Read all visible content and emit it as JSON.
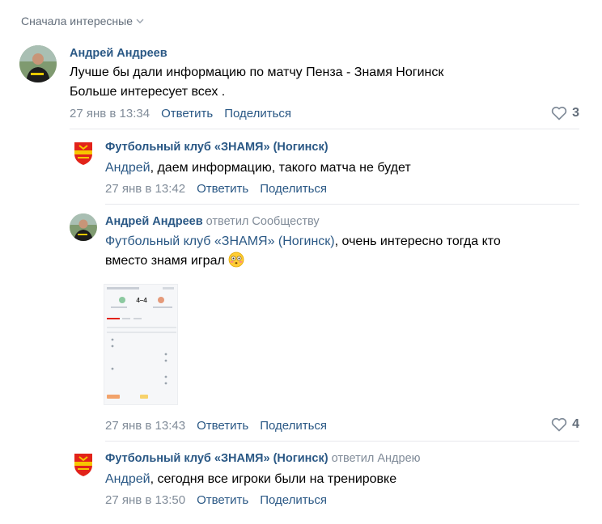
{
  "sort": {
    "label": "Сначала интересные"
  },
  "comments": [
    {
      "author": "Андрей Андреев",
      "lines": [
        "Лучше бы дали информацию по матчу Пенза - Знамя Ногинск",
        "Больше интересует всех ."
      ],
      "date": "27 янв в 13:34",
      "reply": "Ответить",
      "share": "Поделиться",
      "likes": "3"
    },
    {
      "author": "Футбольный клуб «ЗНАМЯ» (Ногинск)",
      "mention": "Андрей",
      "text": ", даем информацию, такого матча не будет",
      "date": "27 янв в 13:42",
      "reply": "Ответить",
      "share": "Поделиться"
    },
    {
      "author": "Андрей Андреев",
      "replied_to": "ответил Сообществу",
      "mention": "Футбольный клуб «ЗНАМЯ» (Ногинск)",
      "text1": ", очень интересно тогда кто",
      "text2": "вместо знамя играл",
      "attachment": {
        "score": "4–4"
      },
      "date": "27 янв в 13:43",
      "reply": "Ответить",
      "share": "Поделиться",
      "likes": "4"
    },
    {
      "author": "Футбольный клуб «ЗНАМЯ» (Ногинск)",
      "replied_to": "ответил Андрею",
      "mention": "Андрей",
      "text": ", сегодня все игроки были на тренировке",
      "date": "27 янв в 13:50",
      "reply": "Ответить",
      "share": "Поделиться"
    }
  ],
  "colors": {
    "link": "#2a5885",
    "muted": "#818c99",
    "club_red": "#e2231a",
    "club_yellow": "#f7c600"
  }
}
